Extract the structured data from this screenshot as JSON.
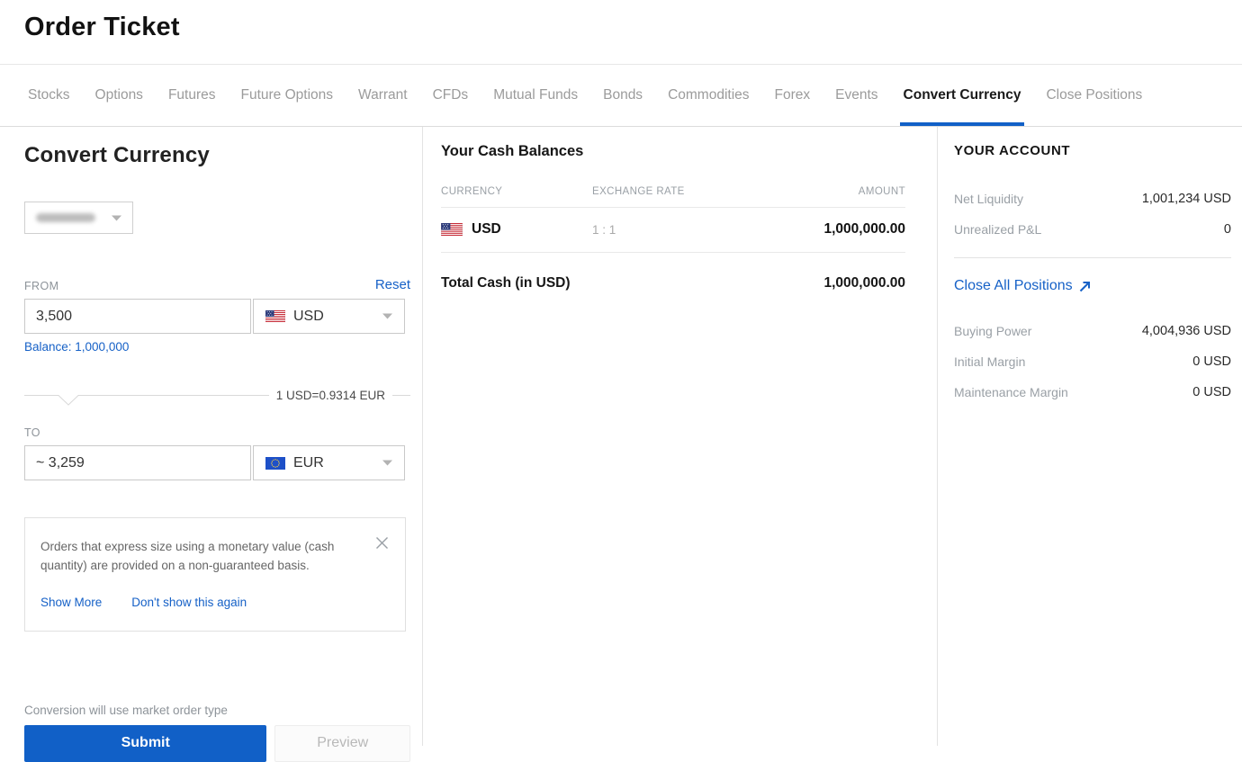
{
  "page": {
    "title": "Order Ticket"
  },
  "tabs": {
    "items": [
      "Stocks",
      "Options",
      "Futures",
      "Future Options",
      "Warrant",
      "CFDs",
      "Mutual Funds",
      "Bonds",
      "Commodities",
      "Forex",
      "Events",
      "Convert Currency",
      "Close Positions"
    ],
    "active": "Convert Currency"
  },
  "convert": {
    "heading": "Convert Currency",
    "from": {
      "label": "FROM",
      "reset_label": "Reset",
      "amount": "3,500",
      "currency": "USD",
      "balance_text": "Balance: 1,000,000"
    },
    "rate_text": "1 USD=0.9314 EUR",
    "to": {
      "label": "TO",
      "amount": "~ 3,259",
      "currency": "EUR"
    },
    "notice": {
      "text": "Orders that express size using a monetary value (cash quantity) are provided on a non-guaranteed basis.",
      "show_more_label": "Show More",
      "dont_show_label": "Don't show this again"
    },
    "footnote": "Conversion will use market order type",
    "submit_label": "Submit",
    "preview_label": "Preview"
  },
  "cash_balances": {
    "heading": "Your Cash Balances",
    "columns": {
      "currency": "CURRENCY",
      "exchange_rate": "EXCHANGE RATE",
      "amount": "AMOUNT"
    },
    "rows": [
      {
        "currency": "USD",
        "flag": "us-flag",
        "exchange_rate": "1 : 1",
        "amount": "1,000,000.00"
      }
    ],
    "total_label": "Total Cash (in USD)",
    "total_amount": "1,000,000.00"
  },
  "account": {
    "heading": "YOUR ACCOUNT",
    "summary": [
      {
        "label": "Net Liquidity",
        "value": "1,001,234 USD"
      },
      {
        "label": "Unrealized P&L",
        "value": "0"
      }
    ],
    "close_all_label": "Close All Positions",
    "margin_rows": [
      {
        "label": "Buying Power",
        "value": "4,004,936 USD"
      },
      {
        "label": "Initial Margin",
        "value": "0 USD"
      },
      {
        "label": "Maintenance Margin",
        "value": "0 USD"
      }
    ]
  },
  "colors": {
    "accent_blue": "#1661c7",
    "submit_blue": "#1160c7",
    "tab_inactive": "#9b9b9b",
    "label_gray": "#9aa0a6"
  }
}
